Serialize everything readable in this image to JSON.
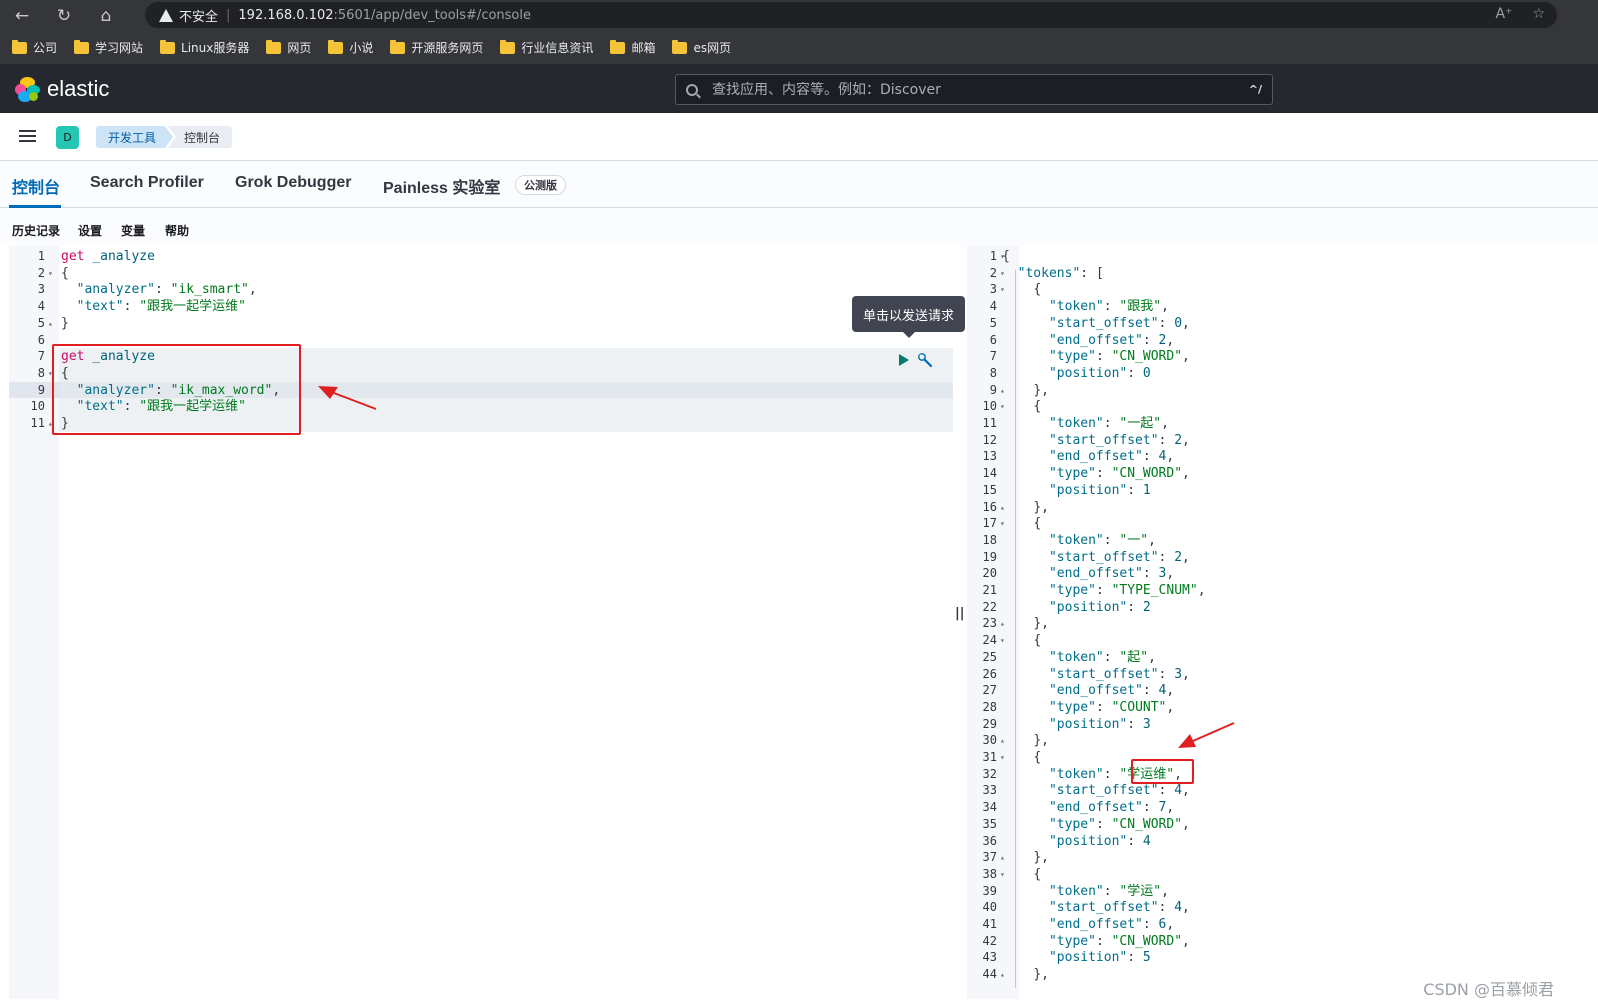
{
  "browser": {
    "security_label": "不安全",
    "url_host": "192.168.0.102",
    "url_path": ":5601/app/dev_tools#/console",
    "bookmarks": [
      "公司",
      "学习网站",
      "Linux服务器",
      "网页",
      "小说",
      "开源服务网页",
      "行业信息资讯",
      "邮箱",
      "es网页"
    ]
  },
  "header": {
    "logo_text": "elastic",
    "search_placeholder": "查找应用、内容等。例如：Discover",
    "search_shortcut": "^/"
  },
  "breadcrumbs": {
    "space_initial": "D",
    "items": [
      "开发工具",
      "控制台"
    ]
  },
  "tabs": [
    {
      "label": "控制台",
      "active": true
    },
    {
      "label": "Search Profiler",
      "active": false
    },
    {
      "label": "Grok Debugger",
      "active": false
    },
    {
      "label": "Painless 实验室",
      "active": false
    }
  ],
  "beta_badge": "公测版",
  "toolbar": [
    "历史记录",
    "设置",
    "变量",
    "帮助"
  ],
  "tooltip": "单击以发送请求",
  "request_lines": [
    [
      "get",
      " ",
      "_analyze"
    ],
    [
      "{"
    ],
    [
      "  ",
      "\"analyzer\"",
      ": ",
      "\"ik_smart\"",
      ","
    ],
    [
      "  ",
      "\"text\"",
      ": ",
      "\"跟我一起学运维\""
    ],
    [
      "}"
    ],
    [
      ""
    ],
    [
      "get",
      " ",
      "_analyze"
    ],
    [
      "{"
    ],
    [
      "  ",
      "\"analyzer\"",
      ": ",
      "\"ik_max_word\"",
      ","
    ],
    [
      "  ",
      "\"text\"",
      ": ",
      "\"跟我一起学运维\""
    ],
    [
      "}"
    ]
  ],
  "response_lines": [
    "{",
    "  \"tokens\": [",
    "    {",
    "      \"token\": \"跟我\",",
    "      \"start_offset\": 0,",
    "      \"end_offset\": 2,",
    "      \"type\": \"CN_WORD\",",
    "      \"position\": 0",
    "    },",
    "    {",
    "      \"token\": \"一起\",",
    "      \"start_offset\": 2,",
    "      \"end_offset\": 4,",
    "      \"type\": \"CN_WORD\",",
    "      \"position\": 1",
    "    },",
    "    {",
    "      \"token\": \"一\",",
    "      \"start_offset\": 2,",
    "      \"end_offset\": 3,",
    "      \"type\": \"TYPE_CNUM\",",
    "      \"position\": 2",
    "    },",
    "    {",
    "      \"token\": \"起\",",
    "      \"start_offset\": 3,",
    "      \"end_offset\": 4,",
    "      \"type\": \"COUNT\",",
    "      \"position\": 3",
    "    },",
    "    {",
    "      \"token\": \"学运维\",",
    "      \"start_offset\": 4,",
    "      \"end_offset\": 7,",
    "      \"type\": \"CN_WORD\",",
    "      \"position\": 4",
    "    },",
    "    {",
    "      \"token\": \"学运\",",
    "      \"start_offset\": 4,",
    "      \"end_offset\": 6,",
    "      \"type\": \"CN_WORD\",",
    "      \"position\": 5",
    "    },"
  ],
  "watermark": "CSDN @百慕倾君"
}
